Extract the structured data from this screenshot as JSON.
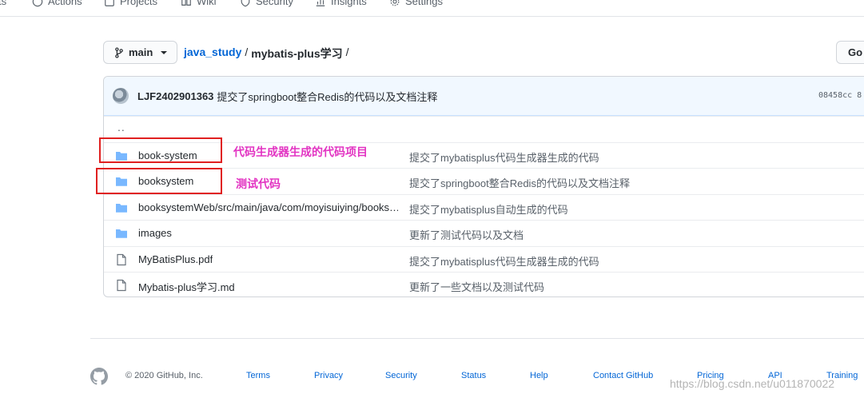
{
  "topnav": {
    "tabs": [
      {
        "label": "ts",
        "icon": "code-icon"
      },
      {
        "label": "Actions",
        "icon": "play-icon"
      },
      {
        "label": "Projects",
        "icon": "project-icon"
      },
      {
        "label": "Wiki",
        "icon": "book-icon"
      },
      {
        "label": "Security",
        "icon": "shield-icon"
      },
      {
        "label": "Insights",
        "icon": "graph-icon"
      },
      {
        "label": "Settings",
        "icon": "gear-icon"
      }
    ]
  },
  "branch": {
    "label": "main"
  },
  "breadcrumb": {
    "repo": "java_study",
    "sep1": "/",
    "dir": "mybatis-plus学习",
    "sep2": "/"
  },
  "goto_button": {
    "label": "Go"
  },
  "commit": {
    "author": "LJF2402901363",
    "message": "提交了springboot整合Redis的代码以及文档注释",
    "sha": "08458cc 8"
  },
  "files": {
    "up": "..",
    "rows": [
      {
        "type": "folder",
        "name": "book-system",
        "message": "提交了mybatisplus代码生成器生成的代码"
      },
      {
        "type": "folder",
        "name": "booksystem",
        "message": "提交了springboot整合Redis的代码以及文档注释"
      },
      {
        "type": "folder",
        "name": "booksystemWeb/src/main/java/com/moyisuiying/books…",
        "message": "提交了mybatisplus自动生成的代码"
      },
      {
        "type": "folder",
        "name": "images",
        "message": "更新了测试代码以及文档"
      },
      {
        "type": "file",
        "name": "MyBatisPlus.pdf",
        "message": "提交了mybatisplus代码生成器生成的代码"
      },
      {
        "type": "file",
        "name": "Mybatis-plus学习.md",
        "message": "更新了一些文档以及测试代码"
      }
    ]
  },
  "annotations": {
    "note1": "代码生成器生成的代码项目",
    "note2": "测试代码"
  },
  "footer": {
    "copyright": "© 2020 GitHub, Inc.",
    "links": [
      "Terms",
      "Privacy",
      "Security",
      "Status",
      "Help",
      "Contact GitHub",
      "Pricing",
      "API",
      "Training"
    ]
  },
  "watermark": "https://blog.csdn.net/u011870022",
  "colors": {
    "link": "#0366d6",
    "folder": "#79b8ff",
    "annotation_box": "#e02020",
    "annotation_text": "#e233c2"
  }
}
